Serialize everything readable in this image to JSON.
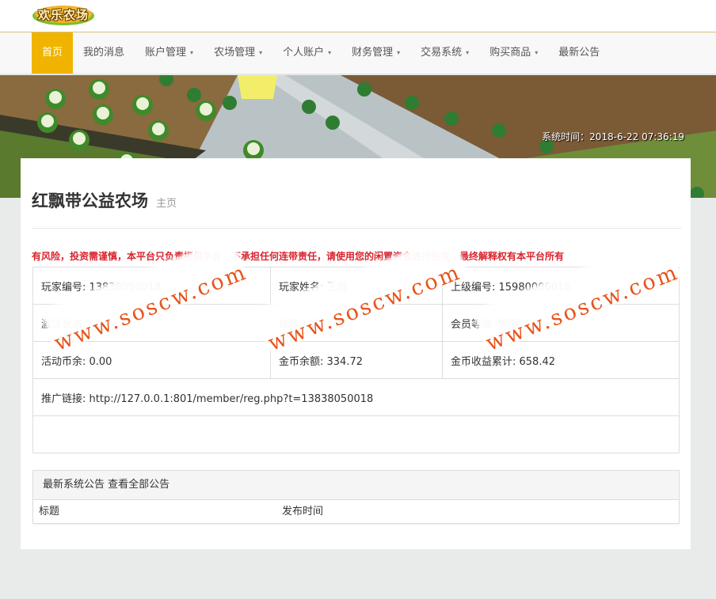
{
  "brand": {
    "logo_text": "欢乐农场"
  },
  "nav": {
    "items": [
      {
        "label": "首页",
        "active": true,
        "caret": false
      },
      {
        "label": "我的消息",
        "active": false,
        "caret": false
      },
      {
        "label": "账户管理",
        "active": false,
        "caret": true
      },
      {
        "label": "农场管理",
        "active": false,
        "caret": true
      },
      {
        "label": "个人账户",
        "active": false,
        "caret": true
      },
      {
        "label": "财务管理",
        "active": false,
        "caret": true
      },
      {
        "label": "交易系统",
        "active": false,
        "caret": true
      },
      {
        "label": "购买商品",
        "active": false,
        "caret": true
      },
      {
        "label": "最新公告",
        "active": false,
        "caret": false
      }
    ],
    "active_color": "#f0b400"
  },
  "banner": {
    "system_time": "系统时间：2018-6-22 07:36:19"
  },
  "page": {
    "title": "红飘带公益农场",
    "subtitle": "主页"
  },
  "risk_notice": "有风险，投资需谨慎，本平台只负责提供平台，不承担任何连带责任，请使用您的闲置资金进行投资，最终解释权有本平台所有",
  "info": {
    "player_id": "玩家编号: 13838050018",
    "player_name": "玩家姓名: 王霞",
    "superior_id": "上级编号: 15980000018",
    "activation": "激活状态:",
    "referrer": "推荐人数:",
    "member_level_label": "会员等级:",
    "member_level_badge": "VIP",
    "coin_balance_a": "活动币余: 0.00",
    "coin_balance_b": "金币余额: 334.72",
    "coin_total": "金币收益累计: 658.42",
    "promo_link": "推广链接: http://127.0.0.1:801/member/reg.php?t=13838050018"
  },
  "announcements": {
    "header": "最新系统公告",
    "view_all": "查看全部公告",
    "col_title": "标题",
    "col_time": "发布时间"
  },
  "watermark": "www.soscw.com",
  "colors": {
    "risk": "#d9242e",
    "watermark": "#e8541a",
    "page_bg": "#e8ebea"
  }
}
